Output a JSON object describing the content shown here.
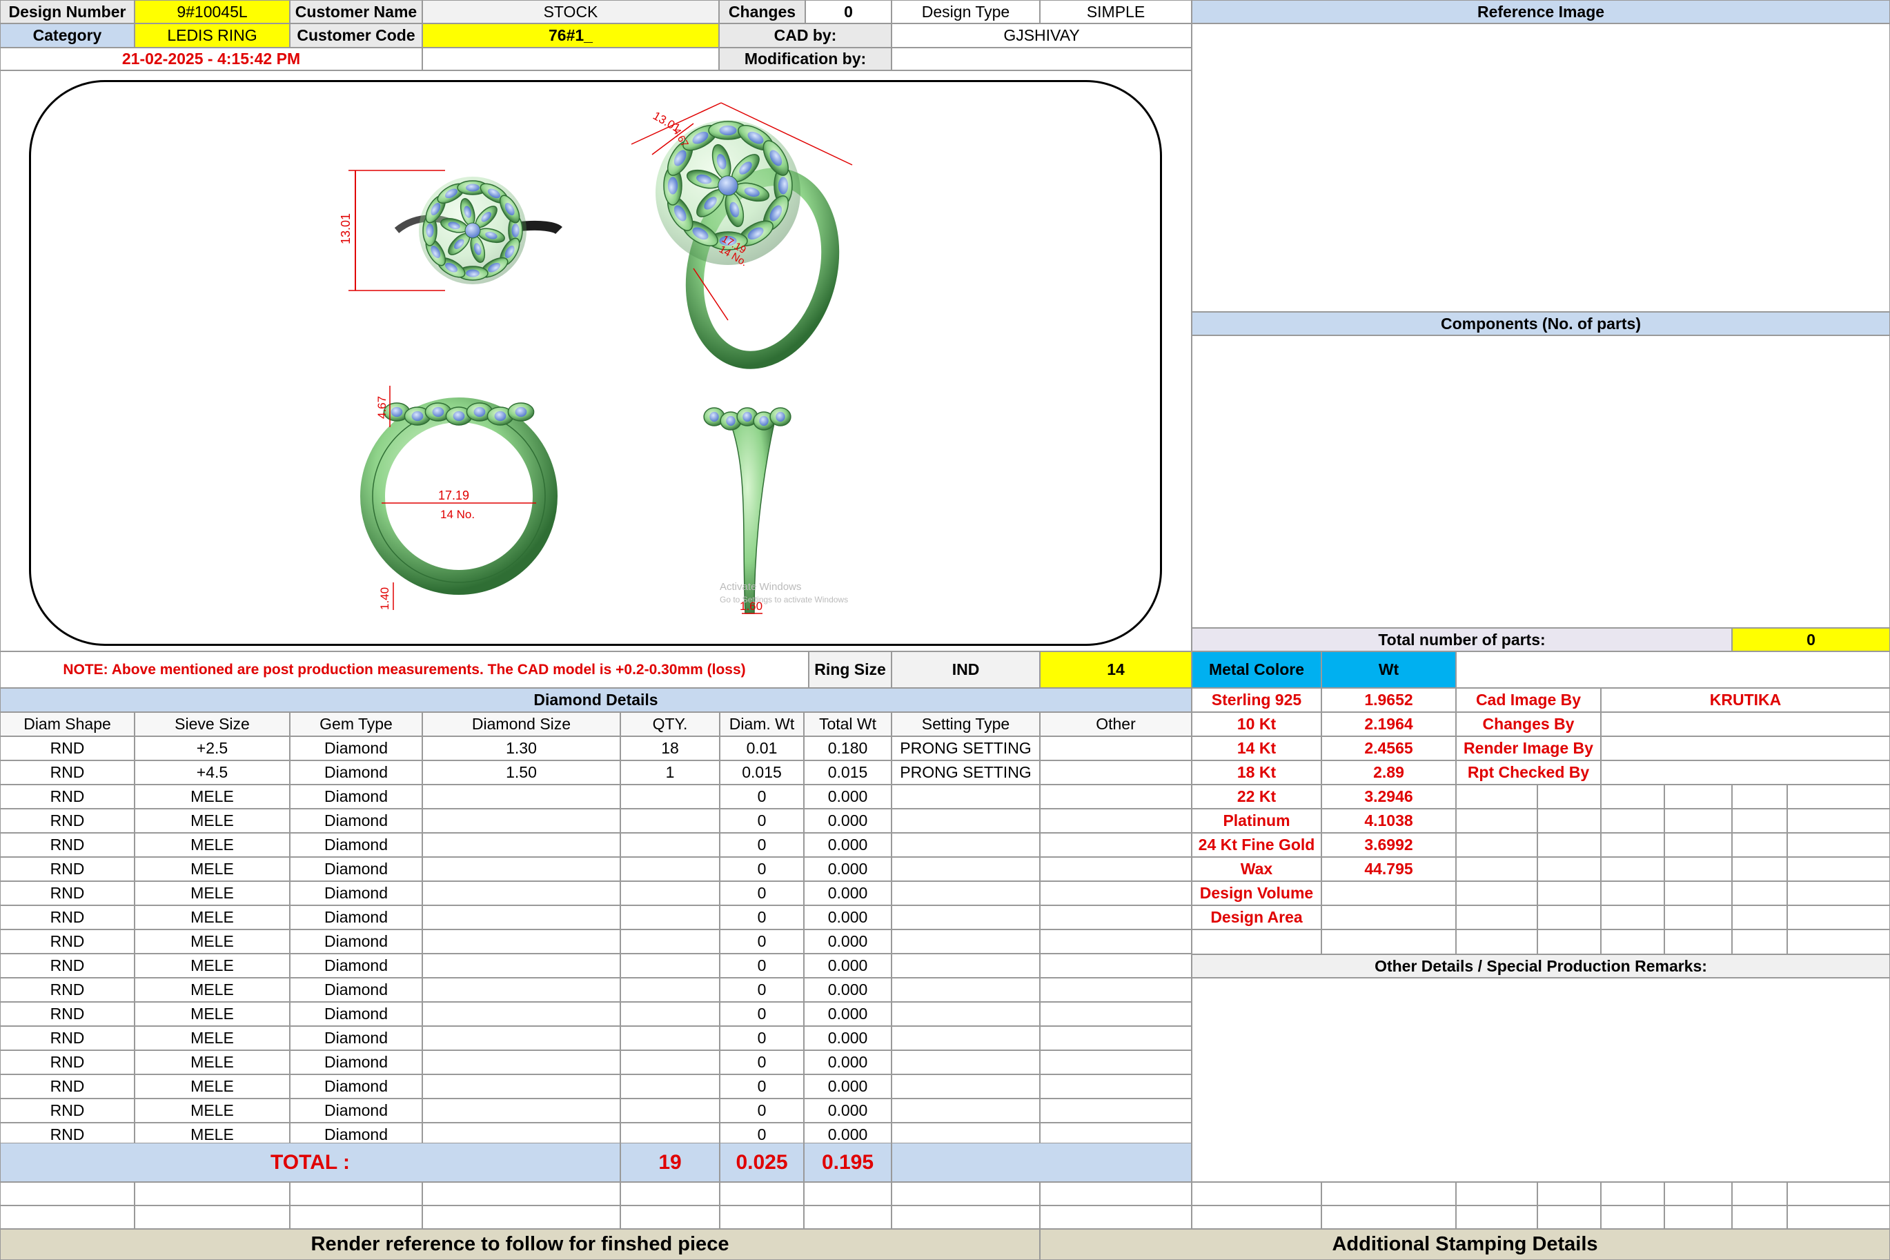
{
  "header": {
    "design_number_label": "Design Number",
    "design_number": "9#10045L",
    "customer_name_label": "Customer Name",
    "customer_name": "STOCK",
    "changes_label": "Changes",
    "changes": "0",
    "design_type_label": "Design Type",
    "design_type": "SIMPLE",
    "reference_image_label": "Reference Image",
    "category_label": "Category",
    "category": "LEDIS RING",
    "customer_code_label": "Customer Code",
    "customer_code": "76#1_",
    "cad_by_label": "CAD by:",
    "cad_by": "GJSHIVAY",
    "datetime": "21-02-2025 - 4:15:42 PM",
    "modification_by_label": "Modification by:",
    "modification_by": ""
  },
  "drawing": {
    "dims": {
      "height_front": "13.01",
      "height_persp": "13.01",
      "top_depth": "4.67",
      "persp_small": "4.67",
      "inner_dia": "17.19",
      "ring_no": "14 No.",
      "shank_thick": "1.40",
      "shank_width": "1.60",
      "persp_dia": "17.19",
      "persp_no": "14 No."
    },
    "watermark_line1": "Activate Windows",
    "watermark_line2": "Go to Settings to activate Windows"
  },
  "note": "NOTE: Above mentioned are post production measurements. The CAD model is +0.2-0.30mm (loss)",
  "ring_size": {
    "label": "Ring Size",
    "standard": "IND",
    "value": "14"
  },
  "metal": {
    "label": "Metal Colore",
    "wt_label": "Wt"
  },
  "diamond_details_title": "Diamond Details",
  "diamond_columns": [
    "Diam Shape",
    "Sieve Size",
    "Gem Type",
    "Diamond Size",
    "QTY.",
    "Diam. Wt",
    "Total Wt",
    "Setting Type",
    "Other"
  ],
  "diamond_rows": [
    [
      "RND",
      "+2.5",
      "Diamond",
      "1.30",
      "18",
      "0.01",
      "0.180",
      "PRONG SETTING",
      ""
    ],
    [
      "RND",
      "+4.5",
      "Diamond",
      "1.50",
      "1",
      "0.015",
      "0.015",
      "PRONG SETTING",
      ""
    ],
    [
      "RND",
      "MELE",
      "Diamond",
      "",
      "",
      "0",
      "0.000",
      "",
      ""
    ],
    [
      "RND",
      "MELE",
      "Diamond",
      "",
      "",
      "0",
      "0.000",
      "",
      ""
    ],
    [
      "RND",
      "MELE",
      "Diamond",
      "",
      "",
      "0",
      "0.000",
      "",
      ""
    ],
    [
      "RND",
      "MELE",
      "Diamond",
      "",
      "",
      "0",
      "0.000",
      "",
      ""
    ],
    [
      "RND",
      "MELE",
      "Diamond",
      "",
      "",
      "0",
      "0.000",
      "",
      ""
    ],
    [
      "RND",
      "MELE",
      "Diamond",
      "",
      "",
      "0",
      "0.000",
      "",
      ""
    ],
    [
      "RND",
      "MELE",
      "Diamond",
      "",
      "",
      "0",
      "0.000",
      "",
      ""
    ],
    [
      "RND",
      "MELE",
      "Diamond",
      "",
      "",
      "0",
      "0.000",
      "",
      ""
    ],
    [
      "RND",
      "MELE",
      "Diamond",
      "",
      "",
      "0",
      "0.000",
      "",
      ""
    ],
    [
      "RND",
      "MELE",
      "Diamond",
      "",
      "",
      "0",
      "0.000",
      "",
      ""
    ],
    [
      "RND",
      "MELE",
      "Diamond",
      "",
      "",
      "0",
      "0.000",
      "",
      ""
    ],
    [
      "RND",
      "MELE",
      "Diamond",
      "",
      "",
      "0",
      "0.000",
      "",
      ""
    ],
    [
      "RND",
      "MELE",
      "Diamond",
      "",
      "",
      "0",
      "0.000",
      "",
      ""
    ],
    [
      "RND",
      "MELE",
      "Diamond",
      "",
      "",
      "0",
      "0.000",
      "",
      ""
    ],
    [
      "RND",
      "MELE",
      "Diamond",
      "",
      "",
      "0",
      "0.000",
      "",
      ""
    ]
  ],
  "totals": {
    "label": "TOTAL :",
    "qty": "19",
    "diam_wt": "0.025",
    "total_wt": "0.195"
  },
  "metal_weights": [
    {
      "name": "Sterling 925",
      "wt": "1.9652"
    },
    {
      "name": "10 Kt",
      "wt": "2.1964"
    },
    {
      "name": "14 Kt",
      "wt": "2.4565"
    },
    {
      "name": "18 Kt",
      "wt": "2.89"
    },
    {
      "name": "22 Kt",
      "wt": "3.2946"
    },
    {
      "name": "Platinum",
      "wt": "4.1038"
    },
    {
      "name": "24 Kt Fine Gold",
      "wt": "3.6992"
    },
    {
      "name": "Wax",
      "wt": "44.795"
    },
    {
      "name": "Design Volume",
      "wt": ""
    },
    {
      "name": "Design Area",
      "wt": ""
    }
  ],
  "credits": [
    {
      "label": "Cad Image By",
      "value": "KRUTIKA"
    },
    {
      "label": "Changes By",
      "value": ""
    },
    {
      "label": "Render Image By",
      "value": ""
    },
    {
      "label": "Rpt Checked By",
      "value": ""
    }
  ],
  "components_label": "Components (No. of parts)",
  "total_parts_label": "Total number of parts:",
  "total_parts": "0",
  "other_details_label": "Other Details / Special Production Remarks:",
  "footer_left": "Render reference to follow for finshed piece",
  "footer_right": "Additional Stamping Details"
}
